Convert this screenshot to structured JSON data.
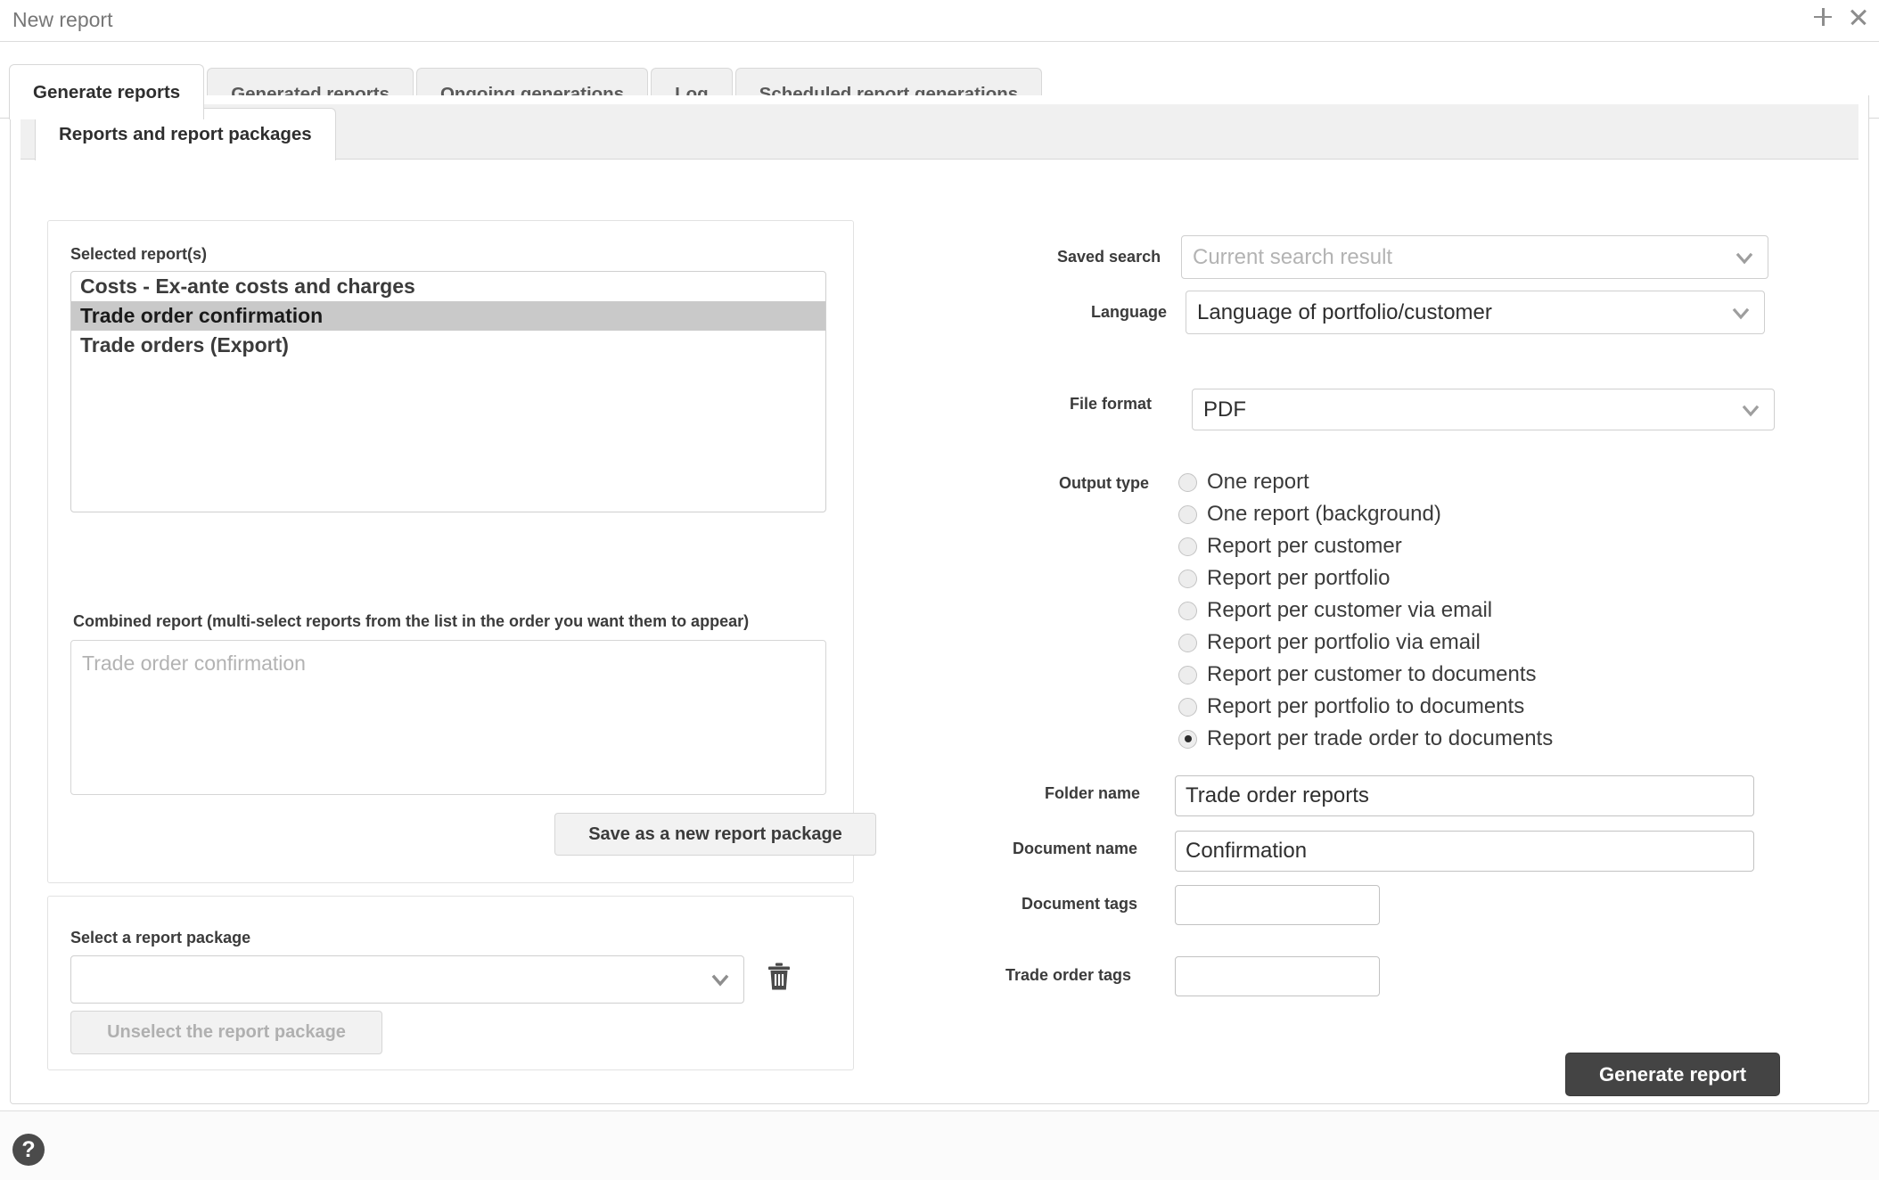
{
  "window": {
    "title": "New report",
    "add_icon": "plus-icon",
    "close_icon": "close-icon"
  },
  "tabs": [
    {
      "label": "Generate reports",
      "active": true
    },
    {
      "label": "Generated reports",
      "active": false
    },
    {
      "label": "Ongoing generations",
      "active": false
    },
    {
      "label": "Log",
      "active": false
    },
    {
      "label": "Scheduled report generations",
      "active": false
    }
  ],
  "inner_tab": {
    "label": "Reports and report packages"
  },
  "left": {
    "selected_reports": {
      "label": "Selected report(s)",
      "items": [
        {
          "label": "Costs - Ex-ante costs and charges",
          "selected": false
        },
        {
          "label": "Trade order confirmation",
          "selected": true
        },
        {
          "label": "Trade orders (Export)",
          "selected": false
        }
      ]
    },
    "combined_report": {
      "label": "Combined report (multi-select reports from the list in the order you want them to appear)",
      "placeholder": "Trade order confirmation",
      "value": ""
    },
    "save_package_button": "Save as a new report package",
    "report_package": {
      "label": "Select a report package",
      "value": "",
      "placeholder": "",
      "delete_icon": "trash-icon",
      "unselect_button": "Unselect the report package"
    }
  },
  "right": {
    "saved_search": {
      "label": "Saved search",
      "value": "Current search result",
      "is_placeholder": true
    },
    "language": {
      "label": "Language",
      "value": "Language of portfolio/customer",
      "is_placeholder": false
    },
    "file_format": {
      "label": "File format",
      "value": "PDF",
      "is_placeholder": false
    },
    "output_type": {
      "label": "Output type",
      "options": [
        {
          "label": "One report",
          "checked": false
        },
        {
          "label": "One report (background)",
          "checked": false
        },
        {
          "label": "Report per customer",
          "checked": false
        },
        {
          "label": "Report per portfolio",
          "checked": false
        },
        {
          "label": "Report per customer via email",
          "checked": false
        },
        {
          "label": "Report per portfolio via email",
          "checked": false
        },
        {
          "label": "Report per customer to documents",
          "checked": false
        },
        {
          "label": "Report per portfolio to documents",
          "checked": false
        },
        {
          "label": "Report per trade order to documents",
          "checked": true
        }
      ]
    },
    "folder_name": {
      "label": "Folder name",
      "value": "Trade order reports"
    },
    "document_name": {
      "label": "Document name",
      "value": "Confirmation"
    },
    "document_tags": {
      "label": "Document tags",
      "value": ""
    },
    "trade_order_tags": {
      "label": "Trade order tags",
      "value": ""
    },
    "generate_button": "Generate report"
  },
  "footer": {
    "help_icon": "help-icon",
    "help_glyph": "?"
  },
  "colors": {
    "accent": "#444444",
    "border": "#d8d8d8",
    "selected_row": "#c9c9c9",
    "placeholder_text": "#b3b3b3"
  }
}
